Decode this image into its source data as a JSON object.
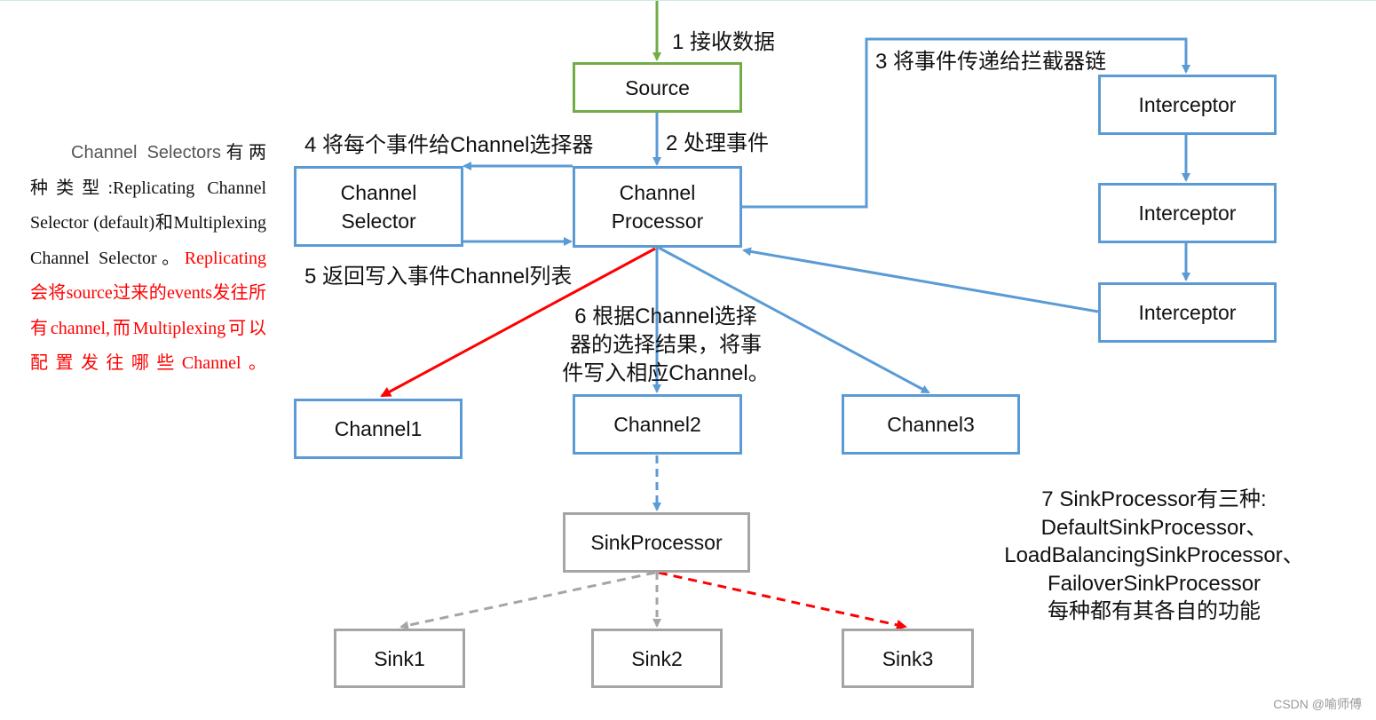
{
  "colors": {
    "blue": "#5b9bd5",
    "green": "#70ad47",
    "gray": "#a5a5a5",
    "red": "#ff0000"
  },
  "nodes": {
    "source": "Source",
    "channel_selector": [
      "Channel",
      "Selector"
    ],
    "channel_processor": [
      "Channel",
      "Processor"
    ],
    "interceptors": [
      "Interceptor",
      "Interceptor",
      "Interceptor"
    ],
    "channels": [
      "Channel1",
      "Channel2",
      "Channel3"
    ],
    "sink_processor": "SinkProcessor",
    "sinks": [
      "Sink1",
      "Sink2",
      "Sink3"
    ]
  },
  "steps": {
    "s1": "1 接收数据",
    "s2": "2 处理事件",
    "s3": "3 将事件传递给拦截器链",
    "s4": "4 将每个事件给Channel选择器",
    "s5": "5 返回写入事件Channel列表",
    "s6": [
      "6 根据Channel选择",
      "器的选择结果，将事",
      "件写入相应Channel。"
    ]
  },
  "left_note": {
    "a": "Channel Selectors",
    "b": "有两种类型:Replicating Channel Selector (default)和Multiplexing Channel Selector。",
    "c": "Replicating 会将source过来的events发往所有channel,而Multiplexing可以配置发往哪些Channel。"
  },
  "sink_note": [
    "7 SinkProcessor有三种:",
    "DefaultSinkProcessor、",
    "LoadBalancingSinkProcessor、",
    "FailoverSinkProcessor",
    "每种都有其各自的功能"
  ],
  "watermark": "CSDN @喻师傅"
}
